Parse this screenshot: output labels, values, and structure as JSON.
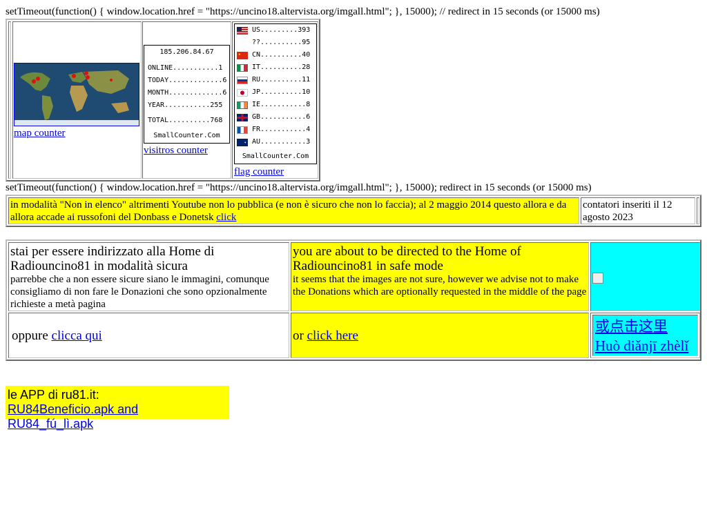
{
  "script_lines": {
    "top": "setTimeout(function() { window.location.href = \"https://uncino18.altervista.org/imgall.html\"; }, 15000); // redirect in 15 seconds (or 15000 ms)",
    "middle": "setTimeout(function() { window.location.href = \"https://uncino18.altervista.org/imgall.html\"; }, 15000); redirect in 15 seconds (or 15000 ms)"
  },
  "counters": {
    "map_link": "map counter",
    "visitors_link": "visitros counter",
    "flag_link": "flag counter",
    "visitors_widget": {
      "ip": "185.206.84.67",
      "rows": [
        "ONLINE...........1",
        "TODAY.............6",
        "MONTH.............6",
        "YEAR...........255",
        "TOTAL..........768"
      ],
      "brand": "SmallCounter.Com"
    },
    "flag_widget": {
      "rows": [
        {
          "code": "US",
          "text": "US.........393",
          "icon": "us-flag-icon"
        },
        {
          "code": "??",
          "text": "??..........95",
          "icon": "unknown-flag-icon"
        },
        {
          "code": "CN",
          "text": "CN..........40",
          "icon": "cn-flag-icon"
        },
        {
          "code": "IT",
          "text": "IT..........28",
          "icon": "it-flag-icon"
        },
        {
          "code": "RU",
          "text": "RU..........11",
          "icon": "ru-flag-icon"
        },
        {
          "code": "JP",
          "text": "JP..........10",
          "icon": "jp-flag-icon"
        },
        {
          "code": "IE",
          "text": "IE...........8",
          "icon": "ie-flag-icon"
        },
        {
          "code": "GB",
          "text": "GB...........6",
          "icon": "gb-flag-icon"
        },
        {
          "code": "FR",
          "text": "FR...........4",
          "icon": "fr-flag-icon"
        },
        {
          "code": "AU",
          "text": "AU...........3",
          "icon": "au-flag-icon"
        }
      ],
      "brand": "SmallCounter.Com"
    }
  },
  "notice": {
    "text": "in modalità \"Non in elenco\" altrimenti Youtube non lo pubblica (e non è sicuro che non lo faccia); al 2 maggio 2014 questo allora e da allora accade ai russofoni del Donbass e Donetsk",
    "link": "click",
    "side": "contatori inseriti il 12 agosto 2023"
  },
  "main": {
    "it_title": "stai per essere indirizzato alla Home di Radiouncino81 in modalità sicura",
    "it_body": "parrebbe che a non essere sicure siano le immagini, comunque consigliamo di non fare le Donazioni che sono opzionalmente richieste a metà pagina",
    "en_title": "you are about to be directed to the Home of Radiouncino81 in safe mode",
    "en_body": "it seems that the images are not sure, however we advise not to make the Donations which are optionally requested in the middle of the page",
    "it_or": "oppure",
    "it_link": "clicca qui",
    "en_or": "or",
    "en_link": "click here",
    "zh_link": "或点击这里",
    "pinyin_link": "Huò diǎnjī zhèlǐ"
  },
  "app": {
    "label": "le APP di ru81.it:",
    "link": "RU84Beneficio.apk and RU84_fú_lì.apk"
  },
  "colors": {
    "yellow": "#ffff00",
    "cyan": "#00ffff",
    "link": "#0000ee"
  }
}
